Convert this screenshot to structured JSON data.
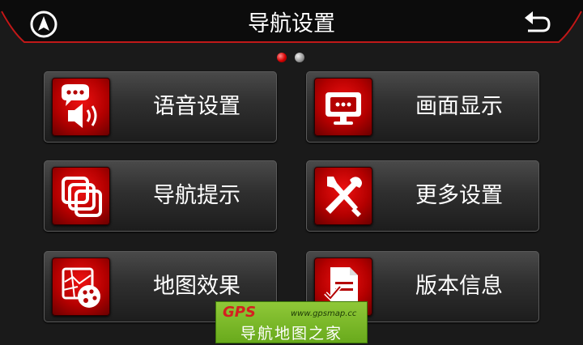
{
  "header": {
    "title": "导航设置",
    "nav_icon": "navigation-arrow-icon",
    "back_icon": "back-arrow-icon"
  },
  "pagination": {
    "pages": 2,
    "current": 1
  },
  "menu": {
    "voice": {
      "label": "语音设置",
      "icon": "voice-speaker-icon"
    },
    "display": {
      "label": "画面显示",
      "icon": "monitor-icon"
    },
    "prompt": {
      "label": "导航提示",
      "icon": "layers-icon"
    },
    "more": {
      "label": "更多设置",
      "icon": "tools-icon"
    },
    "map_effect": {
      "label": "地图效果",
      "icon": "map-palette-icon"
    },
    "version": {
      "label": "版本信息",
      "icon": "document-icon"
    }
  },
  "watermark": {
    "logo": "GPS",
    "url": "www.gpsmap.cc",
    "text": "导航地图之家"
  },
  "colors": {
    "accent": "#d40000",
    "tile_dark": "#1c1c1c",
    "watermark_green": "#7cbc2a"
  }
}
